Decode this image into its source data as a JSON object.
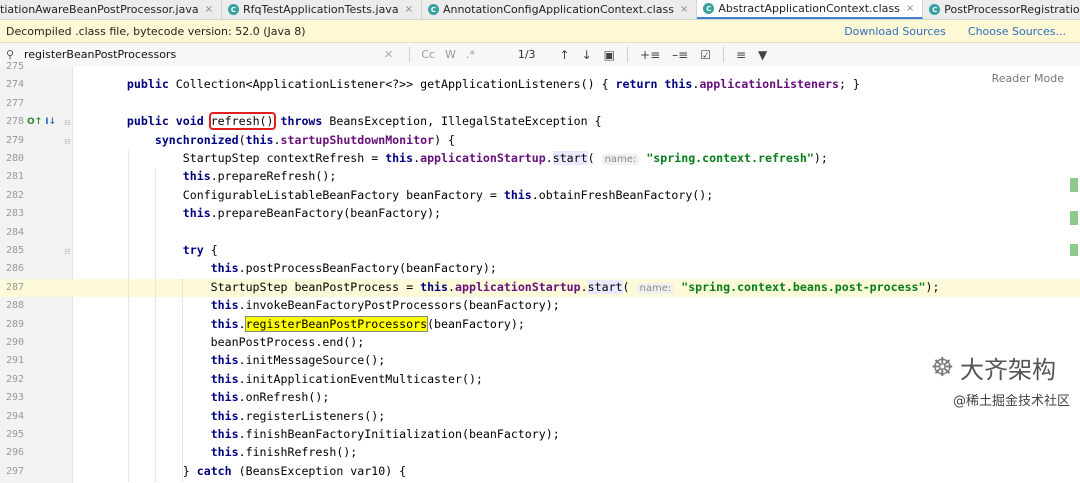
{
  "tabs": [
    {
      "label": "tiationAwareBeanPostProcessor.java",
      "active": false,
      "icon": "class-icon",
      "cut": true
    },
    {
      "label": "RfqTestApplicationTests.java",
      "active": false,
      "icon": "class-icon"
    },
    {
      "label": "AnnotationConfigApplicationContext.class",
      "active": false,
      "icon": "class-icon"
    },
    {
      "label": "AbstractApplicationContext.class",
      "active": true,
      "icon": "class-icon"
    },
    {
      "label": "PostProcessorRegistrationDelegate.class",
      "active": false,
      "icon": "class-icon"
    }
  ],
  "notice": {
    "text": "Decompiled .class file, bytecode version: 52.0 (Java 8)",
    "download_sources": "Download Sources",
    "choose_sources": "Choose Sources..."
  },
  "search": {
    "value": "registerBeanPostProcessors",
    "match_case": "Cc",
    "words": "W",
    "regex": ".*",
    "count": "1/3"
  },
  "editor": {
    "reader_mode": "Reader Mode",
    "lines": [
      {
        "num": "275",
        "t": []
      },
      {
        "num": "274",
        "t": [
          [
            "",
            "    "
          ],
          [
            "kw",
            "public"
          ],
          [
            "",
            " Collection<ApplicationListener<?>> getApplicationListeners() { "
          ],
          [
            "kw",
            "return"
          ],
          [
            "",
            " "
          ],
          [
            "kw",
            "this"
          ],
          [
            "",
            "."
          ],
          [
            "fn",
            "applicationListeners"
          ],
          [
            "",
            "; }"
          ]
        ]
      },
      {
        "num": "277",
        "t": []
      },
      {
        "num": "278",
        "t": [
          [
            "",
            "    "
          ],
          [
            "kw",
            "public void"
          ],
          [
            "",
            " "
          ],
          [
            "box",
            "refresh()"
          ],
          [
            "",
            " "
          ],
          [
            "kw",
            "throws"
          ],
          [
            "",
            " BeansException, IllegalStateException {"
          ]
        ]
      },
      {
        "num": "279",
        "t": [
          [
            "",
            "        "
          ],
          [
            "kw",
            "synchronized"
          ],
          [
            "",
            "("
          ],
          [
            "kw",
            "this"
          ],
          [
            "",
            "."
          ],
          [
            "fn",
            "startupShutdownMonitor"
          ],
          [
            "",
            ") {"
          ]
        ]
      },
      {
        "num": "280",
        "t": [
          [
            "",
            "            StartupStep contextRefresh = "
          ],
          [
            "kw",
            "this"
          ],
          [
            "",
            "."
          ],
          [
            "fn",
            "applicationStartup"
          ],
          [
            "",
            "."
          ],
          [
            "match",
            "start"
          ],
          [
            "",
            "( "
          ],
          [
            "hint",
            "name:"
          ],
          [
            "",
            " "
          ],
          [
            "str",
            "\"spring.context.refresh\""
          ],
          [
            "",
            ");"
          ]
        ]
      },
      {
        "num": "281",
        "t": [
          [
            "",
            "            "
          ],
          [
            "kw",
            "this"
          ],
          [
            "",
            ".prepareRefresh();"
          ]
        ]
      },
      {
        "num": "282",
        "t": [
          [
            "",
            "            ConfigurableListableBeanFactory beanFactory = "
          ],
          [
            "kw",
            "this"
          ],
          [
            "",
            ".obtainFreshBeanFactory();"
          ]
        ]
      },
      {
        "num": "283",
        "t": [
          [
            "",
            "            "
          ],
          [
            "kw",
            "this"
          ],
          [
            "",
            ".prepareBeanFactory(beanFactory);"
          ]
        ]
      },
      {
        "num": "284",
        "t": []
      },
      {
        "num": "285",
        "t": [
          [
            "",
            "            "
          ],
          [
            "kw",
            "try"
          ],
          [
            "",
            " {"
          ]
        ]
      },
      {
        "num": "286",
        "t": [
          [
            "",
            "                "
          ],
          [
            "kw",
            "this"
          ],
          [
            "",
            ".postProcessBeanFactory(beanFactory);"
          ]
        ]
      },
      {
        "num": "287",
        "t": [
          [
            "",
            "                StartupStep beanPostProcess = "
          ],
          [
            "kw",
            "this"
          ],
          [
            "",
            "."
          ],
          [
            "fn",
            "applicationStartup"
          ],
          [
            "",
            "."
          ],
          [
            "match",
            "start"
          ],
          [
            "",
            "( "
          ],
          [
            "hint",
            "name:"
          ],
          [
            "",
            " "
          ],
          [
            "str",
            "\"spring.context.beans.post-process\""
          ],
          [
            "",
            ");"
          ]
        ],
        "current": true
      },
      {
        "num": "288",
        "t": [
          [
            "",
            "                "
          ],
          [
            "kw",
            "this"
          ],
          [
            "",
            ".invokeBeanFactoryPostProcessors(beanFactory);"
          ]
        ]
      },
      {
        "num": "289",
        "t": [
          [
            "",
            "                "
          ],
          [
            "kw",
            "this"
          ],
          [
            "",
            "."
          ],
          [
            "hl",
            "registerBeanPostProcessors"
          ],
          [
            "",
            "(beanFactory);"
          ]
        ]
      },
      {
        "num": "290",
        "t": [
          [
            "",
            "                beanPostProcess.end();"
          ]
        ]
      },
      {
        "num": "291",
        "t": [
          [
            "",
            "                "
          ],
          [
            "kw",
            "this"
          ],
          [
            "",
            ".initMessageSource();"
          ]
        ]
      },
      {
        "num": "292",
        "t": [
          [
            "",
            "                "
          ],
          [
            "kw",
            "this"
          ],
          [
            "",
            ".initApplicationEventMulticaster();"
          ]
        ]
      },
      {
        "num": "293",
        "t": [
          [
            "",
            "                "
          ],
          [
            "kw",
            "this"
          ],
          [
            "",
            ".onRefresh();"
          ]
        ]
      },
      {
        "num": "294",
        "t": [
          [
            "",
            "                "
          ],
          [
            "kw",
            "this"
          ],
          [
            "",
            ".registerListeners();"
          ]
        ]
      },
      {
        "num": "295",
        "t": [
          [
            "",
            "                "
          ],
          [
            "kw",
            "this"
          ],
          [
            "",
            ".finishBeanFactoryInitialization(beanFactory);"
          ]
        ]
      },
      {
        "num": "296",
        "t": [
          [
            "",
            "                "
          ],
          [
            "kw",
            "this"
          ],
          [
            "",
            ".finishRefresh();"
          ]
        ]
      },
      {
        "num": "297",
        "t": [
          [
            "",
            "            } "
          ],
          [
            "kw",
            "catch"
          ],
          [
            "",
            " (BeansException var10) {"
          ]
        ]
      }
    ]
  },
  "watermark": {
    "main": "大齐架构",
    "sub": "@稀土掘金技术社区"
  }
}
